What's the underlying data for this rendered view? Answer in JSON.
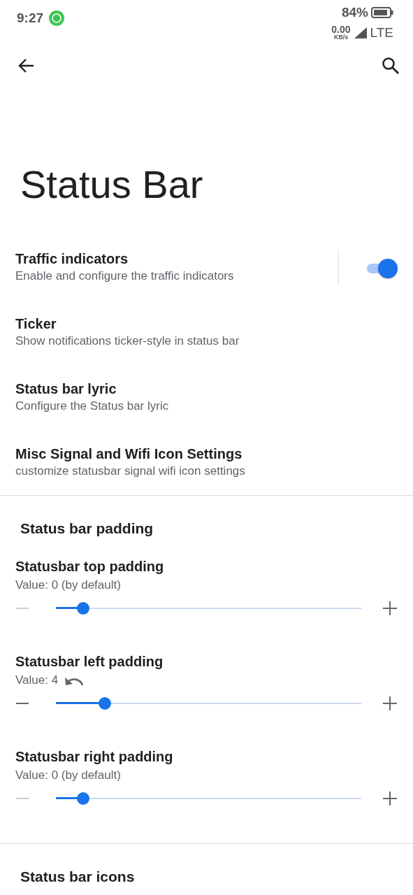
{
  "status_bar": {
    "time": "9:27",
    "battery": "84%",
    "speed": "0.00",
    "speed_unit": "KB/s",
    "network": "LTE"
  },
  "toolbar": {
    "title": "Status Bar"
  },
  "preferences": [
    {
      "title": "Traffic indicators",
      "summary": "Enable and configure the traffic indicators",
      "kind": "switch",
      "on": true
    },
    {
      "title": "Ticker",
      "summary": "Show notifications ticker-style in status bar",
      "kind": "link"
    },
    {
      "title": "Status bar lyric",
      "summary": "Configure the Status bar lyric",
      "kind": "link"
    },
    {
      "title": "Misc Signal and Wifi Icon Settings",
      "summary": "customize statusbar signal wifi icon settings",
      "kind": "link"
    }
  ],
  "sections": [
    {
      "header": "Status bar padding",
      "sliders": [
        {
          "title": "Statusbar top padding",
          "value_text": "Value: 0 (by default)",
          "level": 0.09,
          "minus_disabled": true,
          "reset": false
        },
        {
          "title": "Statusbar left padding",
          "value_text": "Value: 4",
          "level": 0.16,
          "minus_disabled": false,
          "reset": true
        },
        {
          "title": "Statusbar right padding",
          "value_text": "Value: 0 (by default)",
          "level": 0.09,
          "minus_disabled": true,
          "reset": false
        }
      ]
    },
    {
      "header": "Status bar icons"
    }
  ]
}
